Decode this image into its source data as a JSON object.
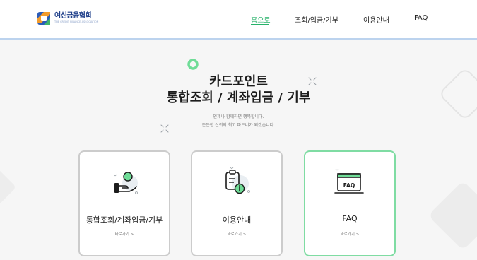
{
  "logo": {
    "name": "여신금융협회",
    "sub": "THE CREDIT FINANCE ASSOCIATION"
  },
  "nav": {
    "home": "홈으로",
    "inquiry": "조회/입금/기부",
    "guide": "이용안내",
    "faq": "FAQ"
  },
  "hero": {
    "title_line1": "카드포인트",
    "title_line2": "통합조회 / 계좌입금 / 기부",
    "desc_line1": "언제나 함께하면 행복합니다.",
    "desc_line2": "든든한 신뢰의 최고 파트너가 되겠습니다."
  },
  "cards": [
    {
      "title": "통합조회/계좌입금/기부",
      "link": "바로가기 >",
      "icon": "hand-coin-icon"
    },
    {
      "title": "이용안내",
      "link": "바로가기 >",
      "icon": "clipboard-info-icon"
    },
    {
      "title": "FAQ",
      "link": "바로가기 >",
      "icon": "faq-monitor-icon"
    }
  ],
  "colors": {
    "accent": "#27b26a",
    "brand": "#1f3f8a",
    "header_border": "#bcd3ee"
  }
}
